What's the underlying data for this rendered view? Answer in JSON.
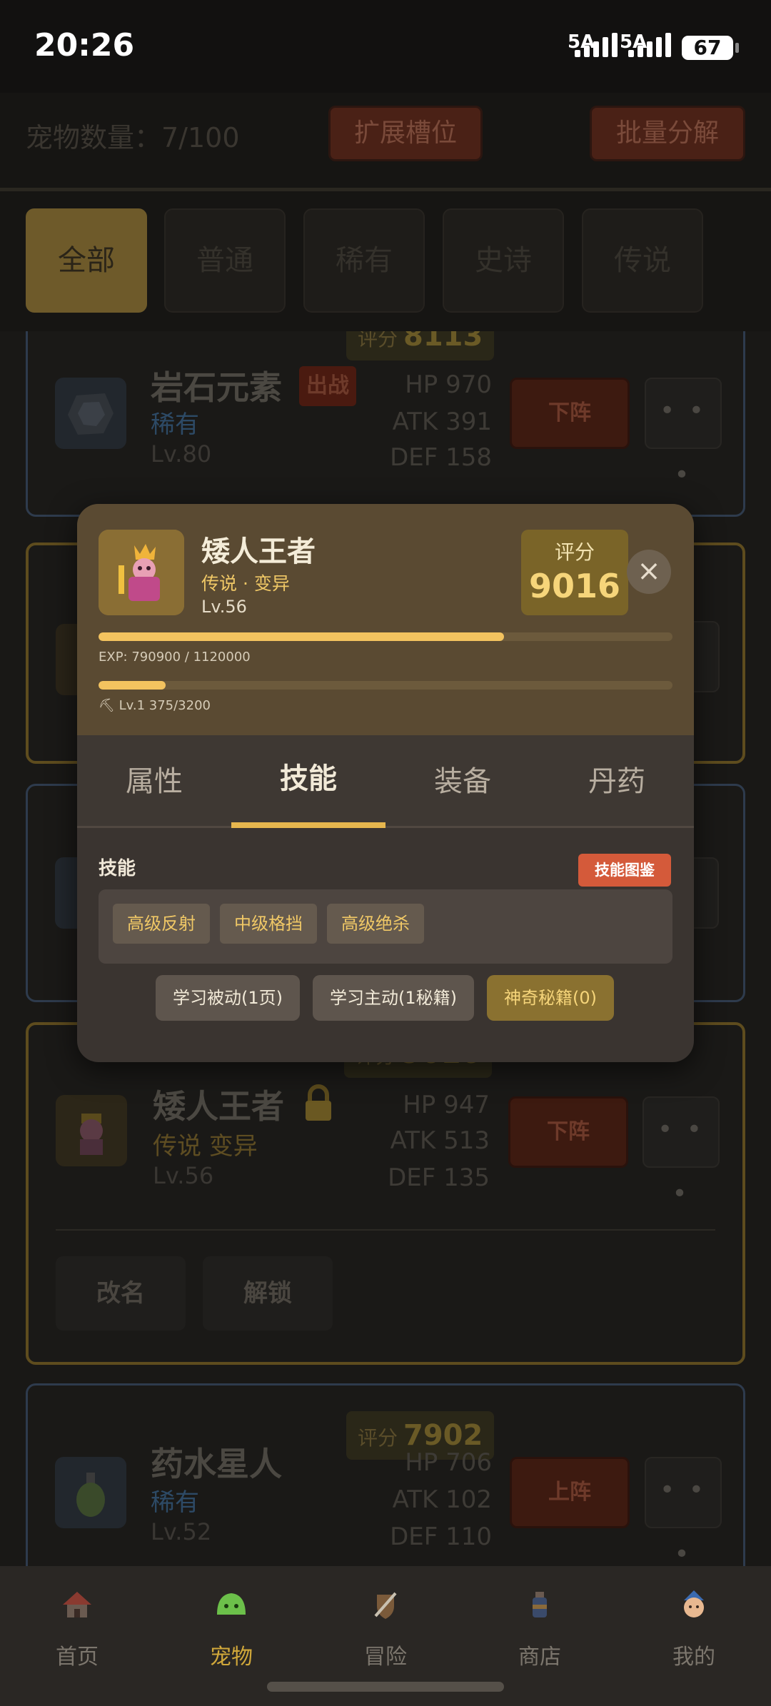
{
  "status": {
    "time": "20:26",
    "net1": "5A",
    "net2": "5A",
    "battery": "67"
  },
  "header": {
    "pet_count": "宠物数量：7/100",
    "expand_label": "扩展槽位",
    "decompose_label": "批量分解"
  },
  "filters": [
    "全部",
    "普通",
    "稀有",
    "史诗",
    "传说"
  ],
  "cards": {
    "rock": {
      "name": "岩石元素",
      "badge": "出战",
      "rarity": "稀有",
      "level": "Lv.80",
      "score_label": "评分",
      "score": "8113",
      "hp": "HP 970",
      "atk": "ATK 391",
      "def": "DEF 158",
      "action": "下阵",
      "more": "• • •"
    },
    "dwarf": {
      "name": "矮人王者",
      "rarity": "传说 变异",
      "level": "Lv.56",
      "score_label": "评分",
      "score": "9016",
      "hp": "HP 947",
      "atk": "ATK 513",
      "def": "DEF 135",
      "action": "下阵",
      "more": "• • •",
      "rename": "改名",
      "unlock": "解锁"
    },
    "potion": {
      "name": "药水星人",
      "rarity": "稀有",
      "level": "Lv.52",
      "score_label": "评分",
      "score": "7902",
      "hp": "HP 706",
      "atk": "ATK 102",
      "def": "DEF 110",
      "action": "上阵",
      "more": "• • •"
    }
  },
  "modal": {
    "name": "矮人王者",
    "tags": "传说 · 变异",
    "level": "Lv.56",
    "score_label": "评分",
    "score": "9016",
    "close": "×",
    "exp_text": "EXP: 790900 / 1120000",
    "exp_progress": 0.706,
    "sub_text": "⛏ Lv.1 375/3200",
    "sub_progress": 0.117,
    "tabs": [
      "属性",
      "技能",
      "装备",
      "丹药"
    ],
    "active_tab": "技能",
    "section_title": "技能",
    "codex_label": "技能图鉴",
    "skills": [
      "高级反射",
      "中级格挡",
      "高级绝杀"
    ],
    "learn_passive": "学习被动(1页)",
    "learn_active": "学习主动(1秘籍)",
    "magic_book": "神奇秘籍(0)"
  },
  "nav": [
    {
      "label": "首页",
      "icon": "house-icon"
    },
    {
      "label": "宠物",
      "icon": "slime-icon"
    },
    {
      "label": "冒险",
      "icon": "sword-shield-icon"
    },
    {
      "label": "商店",
      "icon": "potion-icon"
    },
    {
      "label": "我的",
      "icon": "avatar-icon"
    }
  ],
  "nav_active": "宠物",
  "colors": {
    "accent": "#e6b64e",
    "danger": "#d45a3a",
    "legend_text": "#f0c866"
  }
}
